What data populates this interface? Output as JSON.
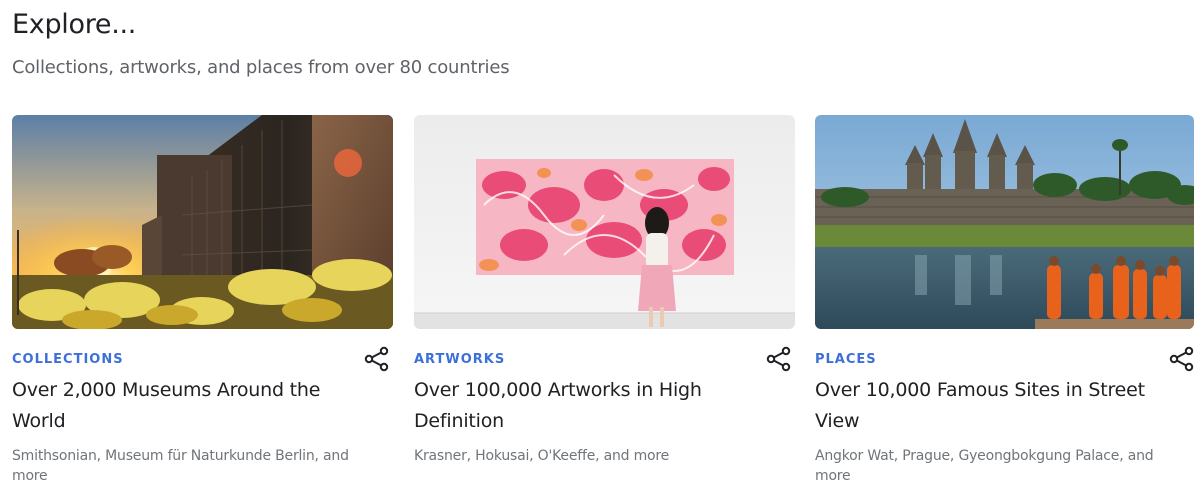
{
  "header": {
    "title": "Explore...",
    "subtitle": "Collections, artworks, and places from over 80 countries"
  },
  "cards": [
    {
      "category": "COLLECTIONS",
      "title": "Over 2,000 Museums Around the World",
      "description": "Smithsonian, Museum für Naturkunde Berlin, and more",
      "image": "museum-building-sunset",
      "share_icon": "share-icon"
    },
    {
      "category": "ARTWORKS",
      "title": "Over 100,000 Artworks in High Definition",
      "description": "Krasner, Hokusai, O'Keeffe, and more",
      "image": "woman-viewing-pink-painting",
      "share_icon": "share-icon"
    },
    {
      "category": "PLACES",
      "title": "Over 10,000 Famous Sites in Street View",
      "description": "Angkor Wat, Prague, Gyeongbokgung Palace, and more",
      "image": "angkor-wat-monks",
      "share_icon": "share-icon"
    }
  ],
  "colors": {
    "accent": "#3c6fd8",
    "title": "#202124",
    "muted": "#5f6368",
    "description": "#70757a"
  }
}
